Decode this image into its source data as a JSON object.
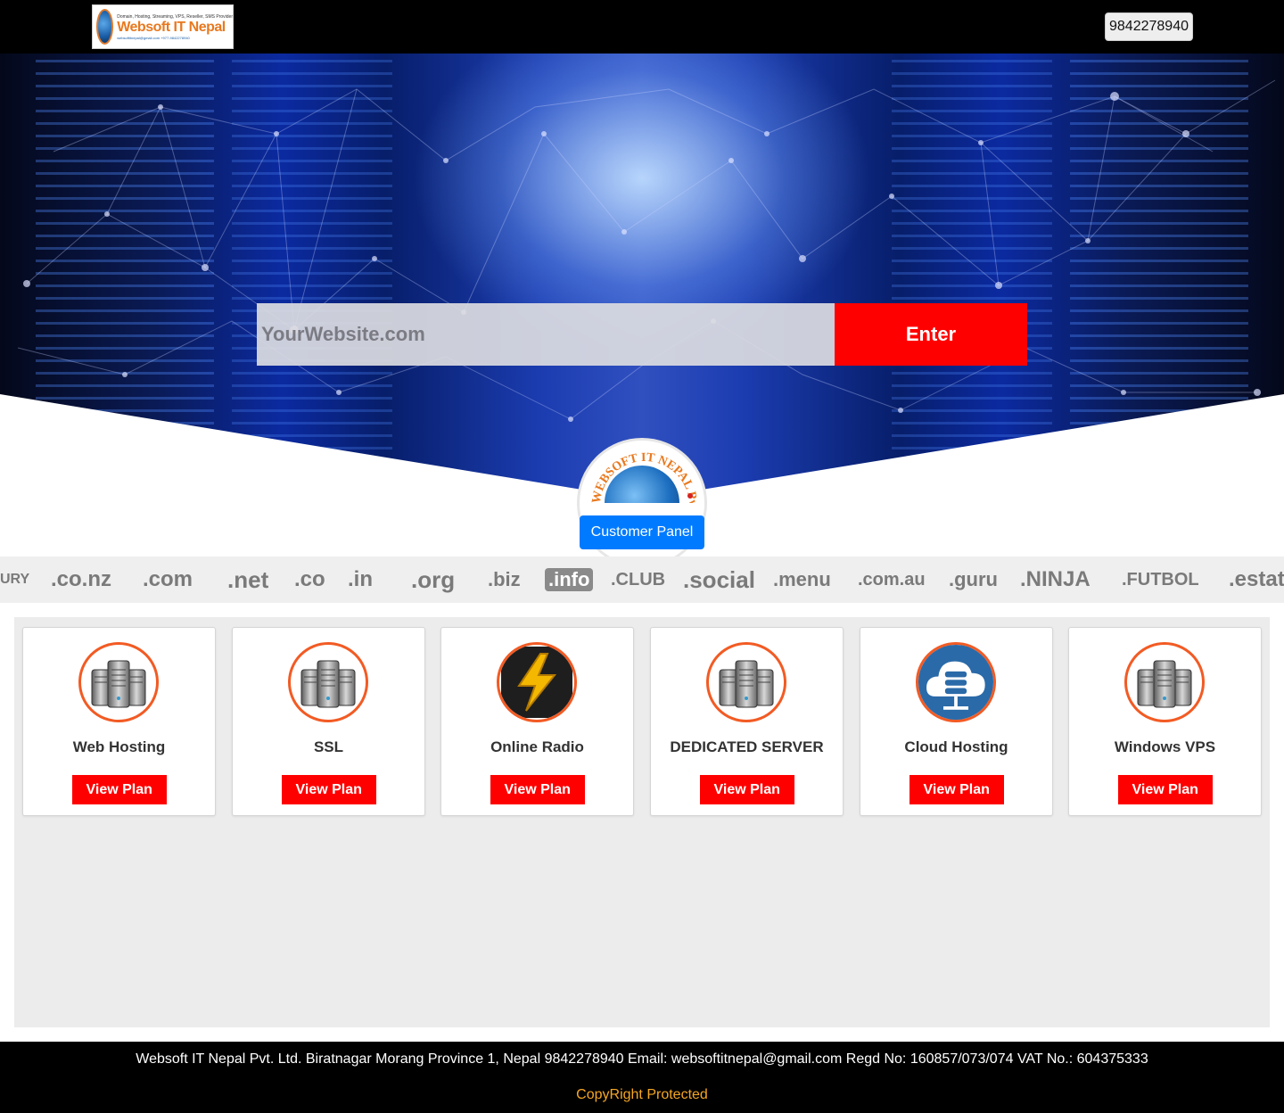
{
  "header": {
    "logo": {
      "name": "Websoft IT Nepal",
      "tagline": "Domain, Hosting, Streaming, VPS, Reseller, SMS Provider",
      "contact": "websoftitnepal@gmail.com  +977-9842278940"
    },
    "phone": "9842278940"
  },
  "hero": {
    "search_placeholder": "YourWebsite.com",
    "enter_label": "Enter",
    "badge_text": "WEBSOFT IT NEPAL Pvt. Ltd.",
    "customer_panel_label": "Customer Panel"
  },
  "tlds": [
    "URY",
    ".co.nz",
    ".com",
    ".net",
    ".co",
    ".in",
    ".org",
    ".biz",
    ".info",
    ".CLUB",
    ".social",
    ".menu",
    ".com.au",
    ".guru",
    ".NINJA",
    ".FUTBOL",
    ".estat"
  ],
  "services": [
    {
      "title": "Web Hosting",
      "button": "View Plan",
      "icon": "server-icon"
    },
    {
      "title": "SSL",
      "button": "View Plan",
      "icon": "server-icon"
    },
    {
      "title": "Online Radio",
      "button": "View Plan",
      "icon": "lightning-icon"
    },
    {
      "title": "DEDICATED SERVER",
      "button": "View Plan",
      "icon": "server-icon"
    },
    {
      "title": "Cloud Hosting",
      "button": "View Plan",
      "icon": "cloud-server-icon"
    },
    {
      "title": "Windows VPS",
      "button": "View Plan",
      "icon": "server-icon"
    }
  ],
  "footer": {
    "info": "Websoft IT Nepal Pvt. Ltd. Biratnagar Morang Province 1, Nepal 9842278940 Email: websoftitnepal@gmail.com Regd No: 160857/073/074 VAT No.: 604375333",
    "copyright": "CopyRight Protected"
  },
  "colors": {
    "accent_red": "#ff0000",
    "primary_blue": "#007bff",
    "icon_ring": "#f25b24",
    "copyright": "#f5a623"
  }
}
